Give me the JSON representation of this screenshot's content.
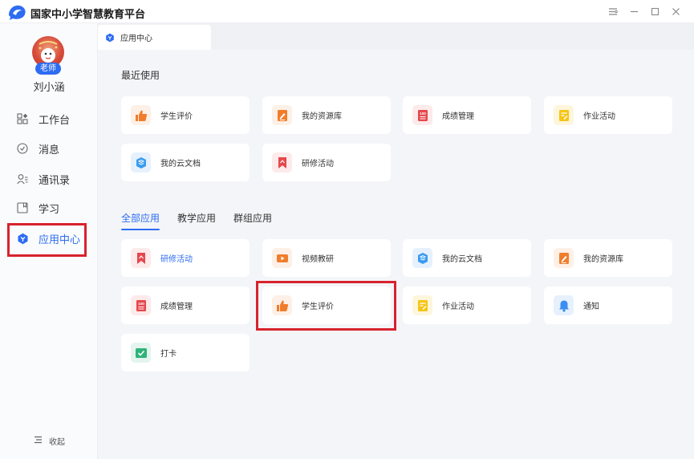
{
  "app": {
    "title": "国家中小学智慧教育平台"
  },
  "user": {
    "name": "刘小涵",
    "role_badge": "老师"
  },
  "sidebar": {
    "items": [
      {
        "label": "工作台",
        "icon": "workbench-icon"
      },
      {
        "label": "消息",
        "icon": "message-icon"
      },
      {
        "label": "通讯录",
        "icon": "contacts-icon"
      },
      {
        "label": "学习",
        "icon": "study-icon"
      },
      {
        "label": "应用中心",
        "icon": "app-center-icon",
        "active": true
      }
    ],
    "collapse_label": "收起"
  },
  "tabs": [
    {
      "label": "应用中心",
      "active": true
    }
  ],
  "recent": {
    "title": "最近使用",
    "apps": [
      {
        "label": "学生评价",
        "icon": "thumbs-up-icon"
      },
      {
        "label": "我的资源库",
        "icon": "resource-library-icon"
      },
      {
        "label": "成绩管理",
        "icon": "grade-management-icon"
      },
      {
        "label": "作业活动",
        "icon": "homework-icon"
      },
      {
        "label": "我的云文档",
        "icon": "cloud-doc-icon"
      },
      {
        "label": "研修活动",
        "icon": "bookmark-icon"
      }
    ]
  },
  "categories": {
    "tabs": [
      {
        "label": "全部应用",
        "active": true
      },
      {
        "label": "教学应用"
      },
      {
        "label": "群组应用"
      }
    ]
  },
  "all_apps": [
    {
      "label": "研修活动",
      "icon": "bookmark-icon",
      "label_color": "#2d6cf3"
    },
    {
      "label": "视频教研",
      "icon": "video-play-icon"
    },
    {
      "label": "我的云文档",
      "icon": "cloud-doc-icon"
    },
    {
      "label": "我的资源库",
      "icon": "resource-library-icon"
    },
    {
      "label": "成绩管理",
      "icon": "grade-management-icon"
    },
    {
      "label": "学生评价",
      "icon": "thumbs-up-icon"
    },
    {
      "label": "作业活动",
      "icon": "homework-icon"
    },
    {
      "label": "通知",
      "icon": "bell-icon"
    },
    {
      "label": "打卡",
      "icon": "check-in-icon"
    }
  ],
  "colors": {
    "accent": "#2d6cf3",
    "highlight": "#d7232e"
  }
}
